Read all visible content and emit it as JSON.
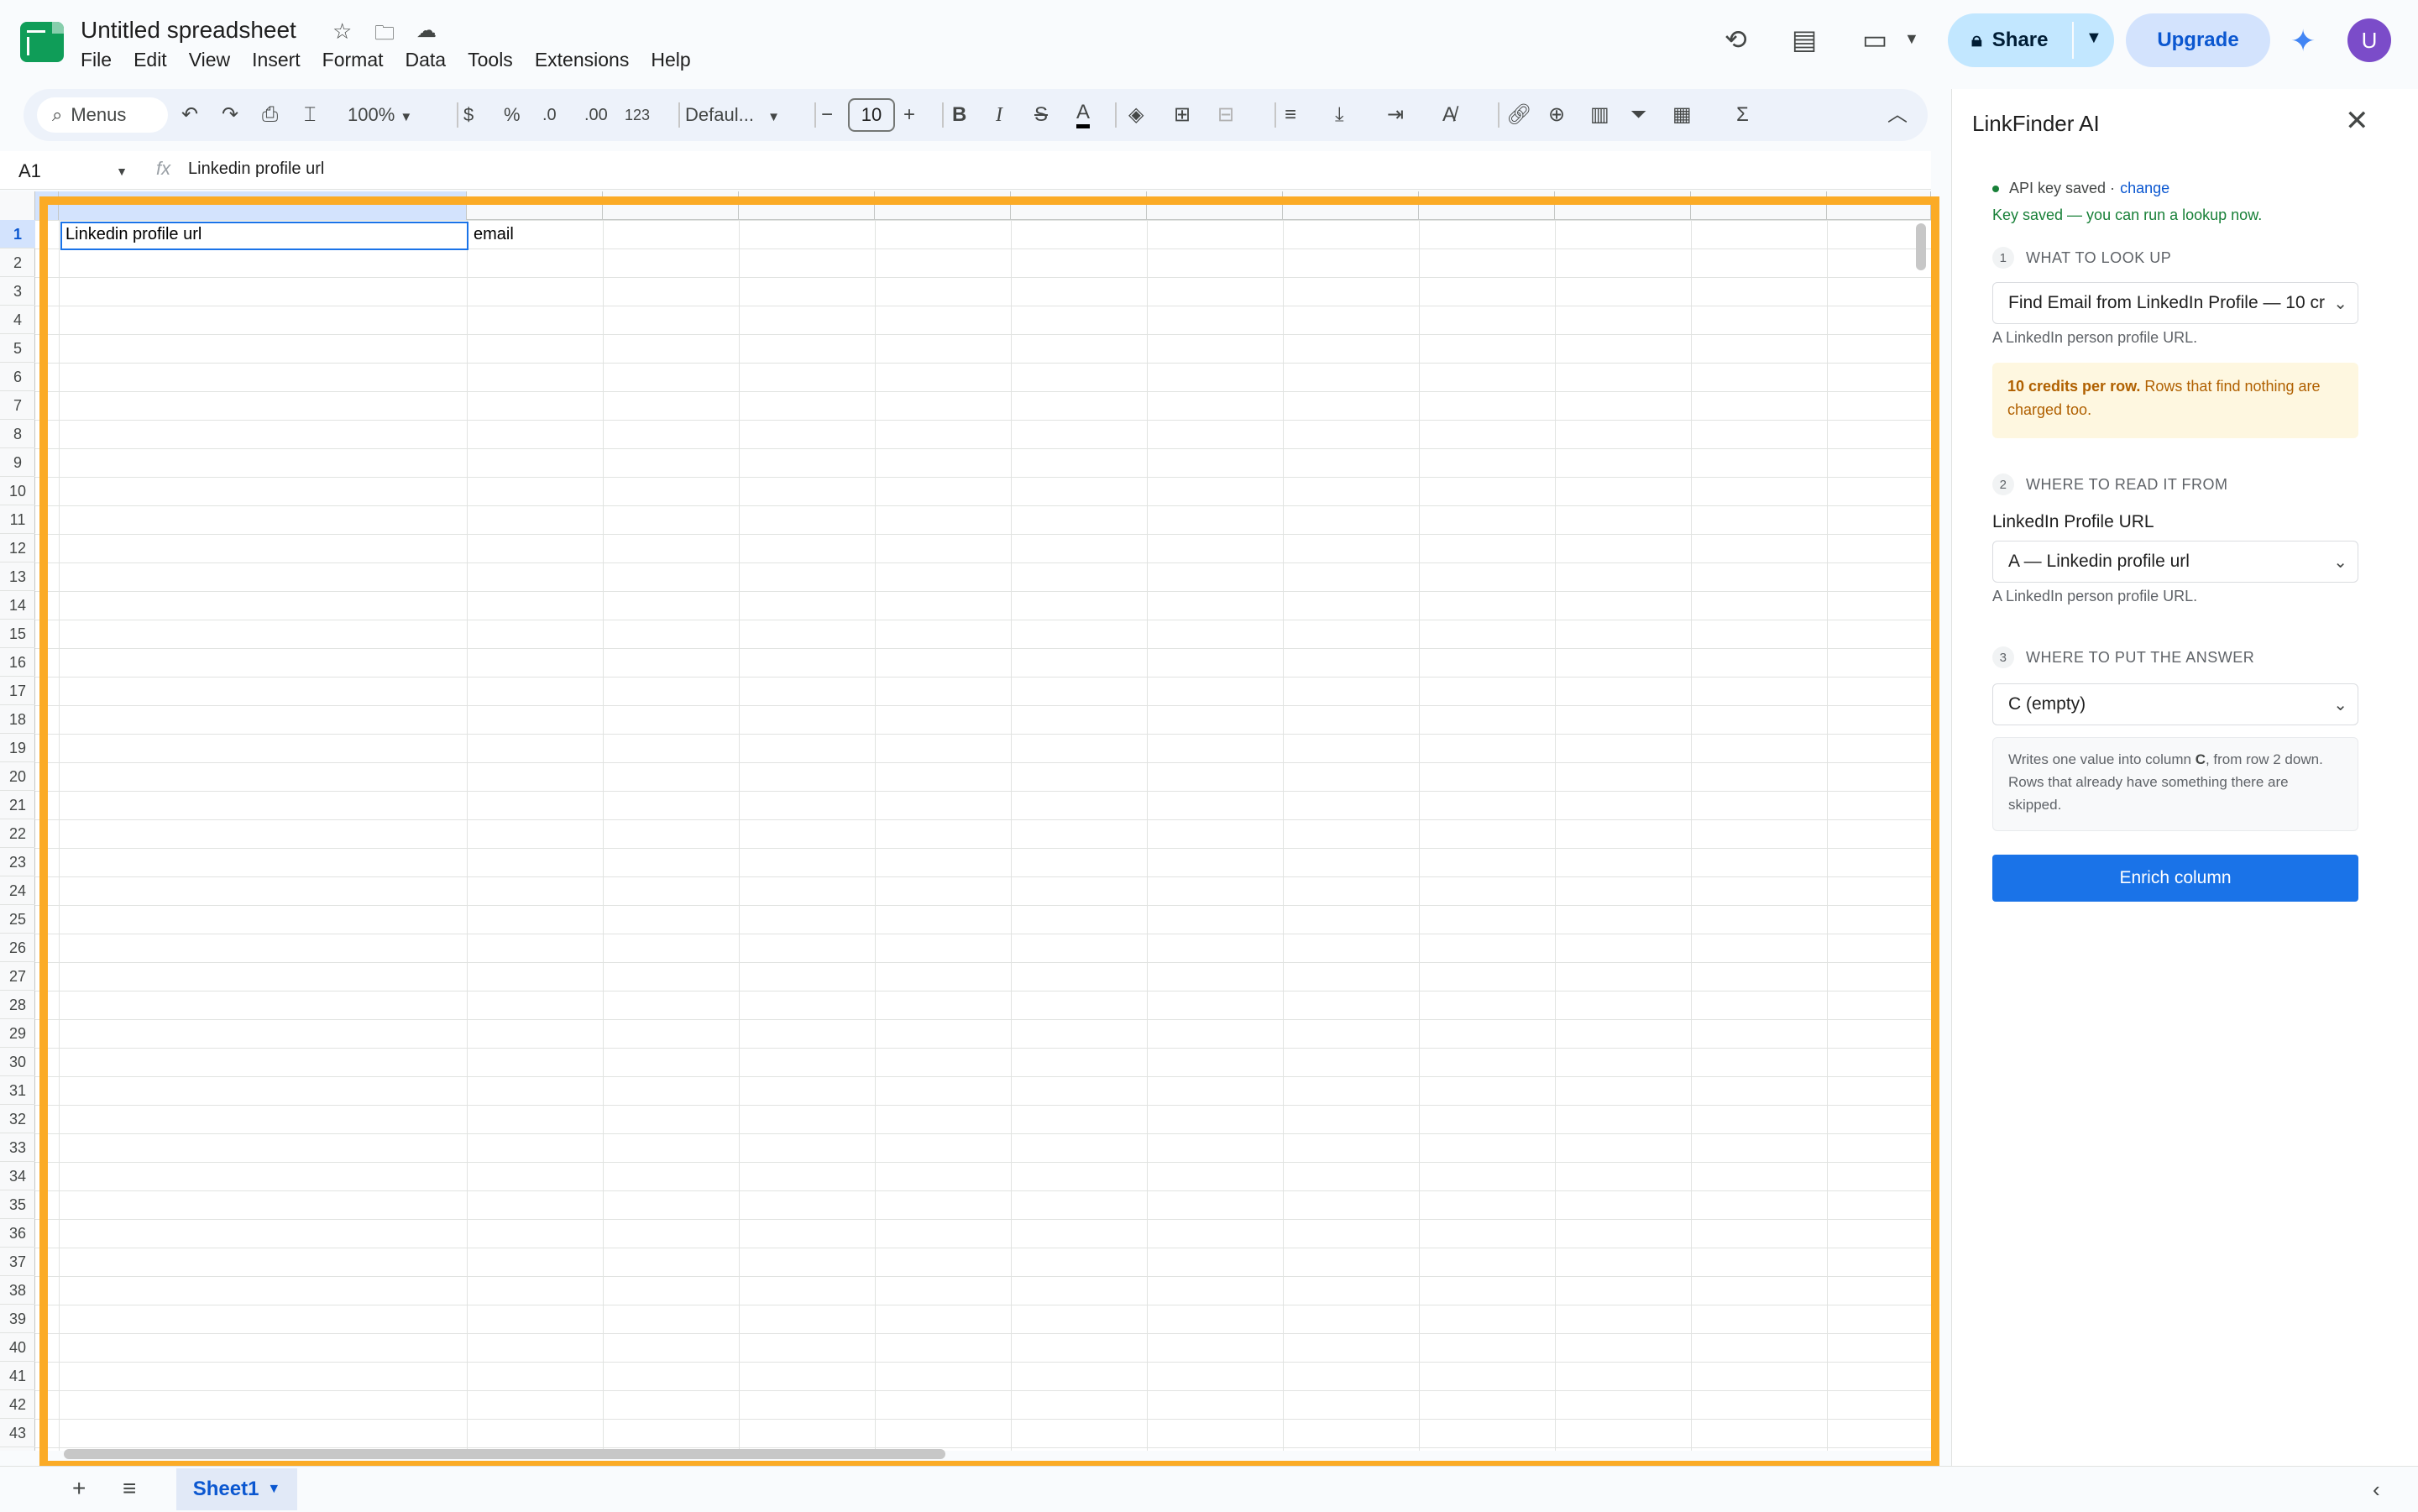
{
  "header": {
    "doc_title": "Untitled spreadsheet",
    "menu": [
      "File",
      "Edit",
      "View",
      "Insert",
      "Format",
      "Data",
      "Tools",
      "Extensions",
      "Help"
    ],
    "share_label": "Share",
    "upgrade_label": "Upgrade",
    "avatar_initial": "U"
  },
  "toolbar": {
    "search_label": "Menus",
    "zoom": "100%",
    "currency": "$",
    "percent": "%",
    "decrease_decimals": ".0",
    "increase_decimals": ".00",
    "number_format": "123",
    "font_name": "Defaul...",
    "font_size": "10"
  },
  "formula_bar": {
    "cell_ref": "A1",
    "fx": "fx",
    "content": "Linkedin profile url"
  },
  "sheet": {
    "cells": {
      "A1": "Linkedin profile url",
      "B1": "email"
    },
    "row_numbers": [
      "1",
      "2",
      "3",
      "4",
      "5",
      "6",
      "7",
      "8",
      "9",
      "10",
      "11",
      "12",
      "13",
      "14",
      "15",
      "16",
      "17",
      "18",
      "19",
      "20",
      "21",
      "22",
      "23",
      "24",
      "25",
      "26",
      "27",
      "28",
      "29",
      "30",
      "31",
      "32",
      "33",
      "34",
      "35",
      "36",
      "37",
      "38",
      "39",
      "40",
      "41",
      "42",
      "43"
    ],
    "tab_name": "Sheet1"
  },
  "panel": {
    "title": "LinkFinder AI",
    "api_status": "API key saved ·",
    "change_link": "change",
    "key_saved_msg": "Key saved — you can run a lookup now.",
    "step1": {
      "num": "1",
      "title": "WHAT TO LOOK UP",
      "selected": "Find Email from LinkedIn Profile — 10 cr",
      "hint": "A LinkedIn person profile URL.",
      "credits_bold": "10 credits per row.",
      "credits_rest": " Rows that find nothing are charged too."
    },
    "step2": {
      "num": "2",
      "title": "WHERE TO READ IT FROM",
      "field_label": "LinkedIn Profile URL",
      "selected": "A — Linkedin profile url",
      "hint": "A LinkedIn person profile URL."
    },
    "step3": {
      "num": "3",
      "title": "WHERE TO PUT THE ANSWER",
      "selected": "C (empty)",
      "writes_pre": "Writes one value into column ",
      "writes_col": "C",
      "writes_post": ", from row 2 down. Rows that already have something there are skipped."
    },
    "enrich_label": "Enrich column"
  },
  "colors": {
    "highlight": "#fbab26",
    "accent": "#1a73e8",
    "share_bg": "#c2e7ff"
  }
}
